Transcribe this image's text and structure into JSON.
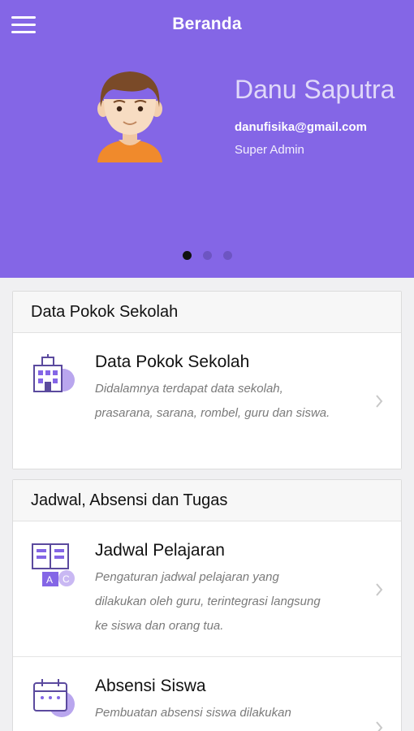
{
  "header": {
    "title": "Beranda",
    "menu_icon": "hamburger-menu-icon"
  },
  "profile": {
    "name": "Danu Saputra",
    "email": "danufisika@gmail.com",
    "role": "Super Admin",
    "avatar_icon": "user-avatar-icon"
  },
  "carousel": {
    "pages": 3,
    "active_index": 0
  },
  "sections": [
    {
      "header": "Data Pokok Sekolah",
      "items": [
        {
          "title": "Data Pokok Sekolah",
          "description": "Didalamnya terdapat data sekolah, prasarana, sarana, rombel, guru dan siswa.",
          "icon": "school-building-icon"
        }
      ]
    },
    {
      "header": "Jadwal, Absensi dan Tugas",
      "items": [
        {
          "title": "Jadwal Pelajaran",
          "description": "Pengaturan jadwal pelajaran yang dilakukan oleh guru, terintegrasi langsung ke siswa dan orang tua.",
          "icon": "schedule-book-icon"
        },
        {
          "title": "Absensi Siswa",
          "description": "Pembuatan absensi siswa dilakukan",
          "icon": "attendance-calendar-icon"
        }
      ]
    }
  ],
  "colors": {
    "primary": "#8466e6",
    "dot_active": "#111111",
    "dot_inactive": "#6d55c2"
  }
}
